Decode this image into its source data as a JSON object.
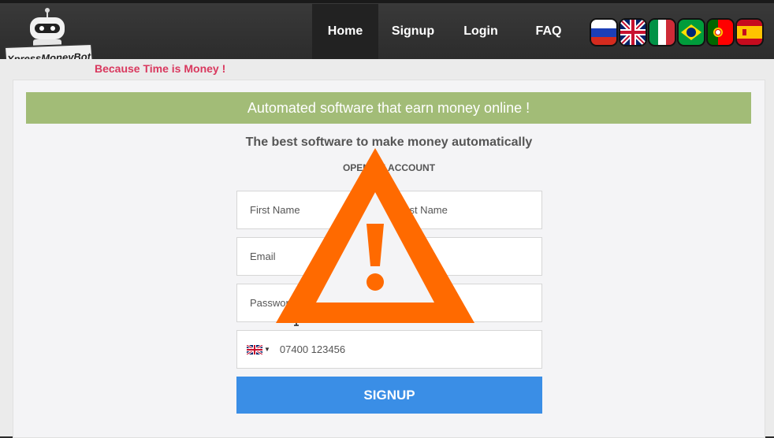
{
  "brand": {
    "logo_text": "XpressMoneyBot",
    "tagline": "Because Time is Money !"
  },
  "nav": {
    "home": "Home",
    "signup": "Signup",
    "login": "Login",
    "faq": "FAQ"
  },
  "languages": [
    "russian-flag",
    "uk-flag",
    "italy-flag",
    "brazil-flag",
    "portugal-flag",
    "spain-flag"
  ],
  "banner": "Automated software that earn money online !",
  "headline": "The best software to make money automatically",
  "subhead": "OPEN AN ACCOUNT",
  "form": {
    "first_name_placeholder": "First Name",
    "last_name_placeholder": "Last Name",
    "email_placeholder": "Email",
    "password_placeholder": "Password",
    "phone_placeholder": "07400 123456",
    "submit_label": "SIGNUP"
  },
  "colors": {
    "banner": "#a2bc77",
    "button": "#3a8ee6",
    "tagline": "#d9385e",
    "warning": "#ff6a00"
  },
  "overlay_icon": "warning-triangle-icon"
}
